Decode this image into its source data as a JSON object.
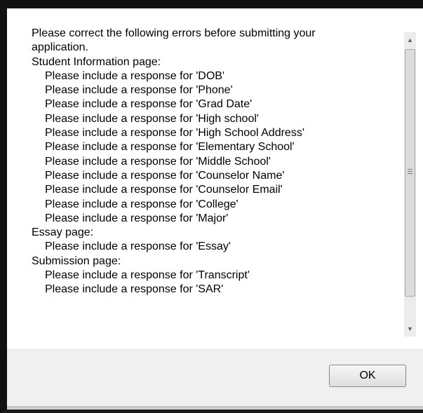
{
  "dialog": {
    "lines": [
      {
        "text": "Please correct the following errors before submitting your",
        "indent": false
      },
      {
        "text": "application.",
        "indent": false
      },
      {
        "text": "Student Information page:",
        "indent": false
      },
      {
        "text": "Please include a response for 'DOB'",
        "indent": true
      },
      {
        "text": "Please include a response for 'Phone'",
        "indent": true
      },
      {
        "text": "Please include a response for 'Grad Date'",
        "indent": true
      },
      {
        "text": "Please include a response for 'High school'",
        "indent": true
      },
      {
        "text": "Please include a response for 'High School Address'",
        "indent": true
      },
      {
        "text": "Please include a response for 'Elementary School'",
        "indent": true
      },
      {
        "text": "Please include a response for 'Middle School'",
        "indent": true
      },
      {
        "text": "Please include a response for 'Counselor Name'",
        "indent": true
      },
      {
        "text": "Please include a response for 'Counselor Email'",
        "indent": true
      },
      {
        "text": "Please include a response for 'College'",
        "indent": true
      },
      {
        "text": "Please include a response for 'Major'",
        "indent": true
      },
      {
        "text": "Essay page:",
        "indent": false
      },
      {
        "text": "Please include a response for 'Essay'",
        "indent": true
      },
      {
        "text": "Submission page:",
        "indent": false
      },
      {
        "text": "Please include a response for 'Transcript'",
        "indent": true
      },
      {
        "text": "Please include a response for 'SAR'",
        "indent": true
      }
    ],
    "ok_label": "OK"
  },
  "scrollbar": {
    "up_icon": "scroll-up-arrow-icon",
    "down_icon": "scroll-down-arrow-icon"
  }
}
